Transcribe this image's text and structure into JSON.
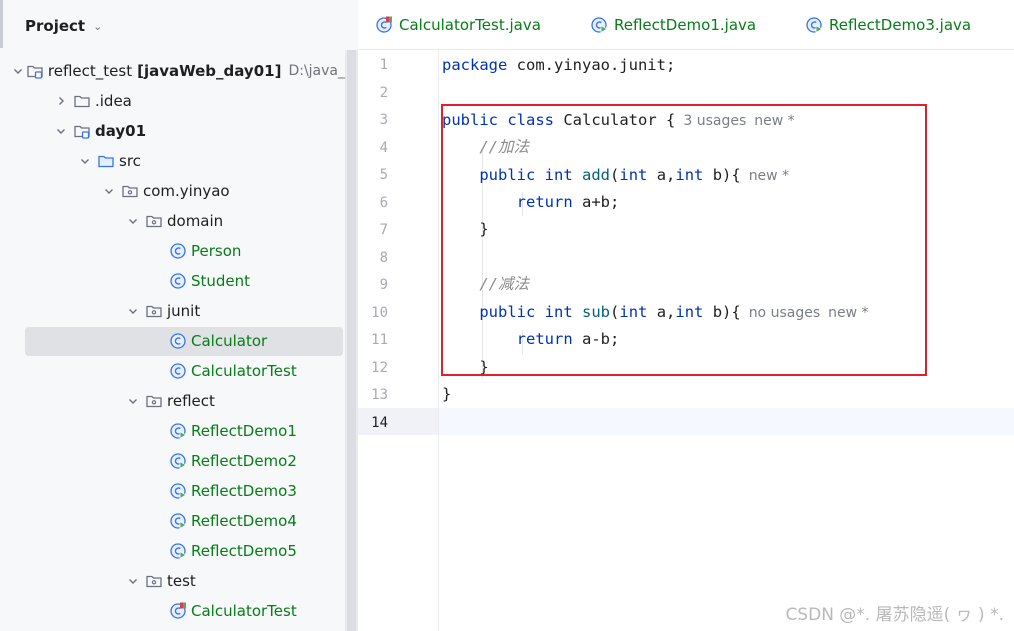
{
  "project_panel": {
    "title": "Project",
    "tree": [
      {
        "label": "reflect_test",
        "suffix": "[javaWeb_day01]",
        "path": "D:\\java_",
        "icon": "module-folder-icon",
        "arrow": "down",
        "color": "black"
      },
      {
        "label": ".idea",
        "icon": "folder-icon",
        "arrow": "right",
        "color": "black"
      },
      {
        "label": "day01",
        "icon": "module-folder-icon",
        "arrow": "down",
        "color": "black",
        "bold": true
      },
      {
        "label": "src",
        "icon": "source-folder-icon",
        "arrow": "down",
        "color": "black"
      },
      {
        "label": "com.yinyao",
        "icon": "package-icon",
        "arrow": "down",
        "color": "black"
      },
      {
        "label": "domain",
        "icon": "package-icon",
        "arrow": "down",
        "color": "black"
      },
      {
        "label": "Person",
        "icon": "class-icon",
        "color": "green"
      },
      {
        "label": "Student",
        "icon": "class-icon",
        "color": "green"
      },
      {
        "label": "junit",
        "icon": "package-icon",
        "arrow": "down",
        "color": "black"
      },
      {
        "label": "Calculator",
        "icon": "class-icon",
        "color": "green",
        "selected": true
      },
      {
        "label": "CalculatorTest",
        "icon": "class-icon",
        "color": "green"
      },
      {
        "label": "reflect",
        "icon": "package-icon",
        "arrow": "down",
        "color": "black"
      },
      {
        "label": "ReflectDemo1",
        "icon": "runnable-class-icon",
        "color": "green"
      },
      {
        "label": "ReflectDemo2",
        "icon": "runnable-class-icon",
        "color": "green"
      },
      {
        "label": "ReflectDemo3",
        "icon": "runnable-class-icon",
        "color": "green"
      },
      {
        "label": "ReflectDemo4",
        "icon": "runnable-class-icon",
        "color": "green"
      },
      {
        "label": "ReflectDemo5",
        "icon": "runnable-class-icon",
        "color": "green"
      },
      {
        "label": "test",
        "icon": "package-icon",
        "arrow": "down",
        "color": "black"
      },
      {
        "label": "CalculatorTest",
        "icon": "test-class-icon",
        "color": "green"
      }
    ]
  },
  "editor": {
    "tabs": [
      {
        "label": "CalculatorTest.java",
        "icon": "test-class-icon"
      },
      {
        "label": "ReflectDemo1.java",
        "icon": "runnable-class-icon"
      },
      {
        "label": "ReflectDemo3.java",
        "icon": "runnable-class-icon"
      }
    ],
    "line_numbers": [
      "1",
      "2",
      "3",
      "4",
      "5",
      "6",
      "7",
      "8",
      "9",
      "10",
      "11",
      "12",
      "13",
      "14"
    ],
    "code": {
      "l1": {
        "kw": "package",
        "rest": " com.yinyao.junit;"
      },
      "l3": {
        "kw1": "public",
        "kw2": "class",
        "name": " Calculator {",
        "hint1": "3 usages",
        "hint2": "new *"
      },
      "l4": {
        "comment": "//加法"
      },
      "l5": {
        "kw1": "public",
        "kw2": "int",
        "fn": "add",
        "p1": "int",
        "a": " a,",
        "p2": "int",
        "b": " b){",
        "hint": "new *"
      },
      "l6": {
        "kw": "return",
        "rest": " a+b;"
      },
      "l7": {
        "text": "}"
      },
      "l9": {
        "comment": "//减法"
      },
      "l10": {
        "kw1": "public",
        "kw2": "int",
        "fn": "sub",
        "p1": "int",
        "a": " a,",
        "p2": "int",
        "b": " b){",
        "hint1": "no usages",
        "hint2": "new *"
      },
      "l11": {
        "kw": "return",
        "rest": " a-b;"
      },
      "l12": {
        "text": "}"
      },
      "l13": {
        "text": "}"
      }
    }
  },
  "watermark": "CSDN @*. 屠苏隐遥( ヮ ) *.",
  "colors": {
    "keyword": "#0033b3",
    "function": "#00627a",
    "comment": "#8c8c8c",
    "class_label": "#067d17",
    "highlight_box": "#e0202d"
  }
}
